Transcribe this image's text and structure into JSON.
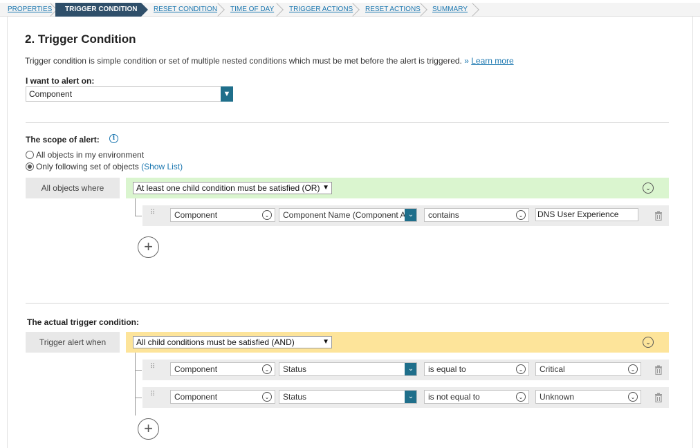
{
  "wizard": {
    "steps": [
      {
        "label": "PROPERTIES",
        "active": false
      },
      {
        "label": "TRIGGER CONDITION",
        "active": true
      },
      {
        "label": "RESET CONDITION",
        "active": false
      },
      {
        "label": "TIME OF DAY",
        "active": false
      },
      {
        "label": "TRIGGER ACTIONS",
        "active": false
      },
      {
        "label": "RESET ACTIONS",
        "active": false
      },
      {
        "label": "SUMMARY",
        "active": false
      }
    ]
  },
  "page": {
    "title": "2. Trigger Condition",
    "description": "Trigger condition is simple condition or set of multiple nested conditions which must be met before the alert is triggered.",
    "learn_more_prefix": "»",
    "learn_more": "Learn more"
  },
  "alert_on": {
    "label": "I want to alert on:",
    "value": "Component"
  },
  "scope": {
    "label": "The scope of alert:",
    "options": [
      {
        "label": "All objects in my environment",
        "selected": false
      },
      {
        "label": "Only following set of objects",
        "selected": true,
        "link": "(Show List)"
      }
    ],
    "group_label": "All objects where",
    "group_operator": "At least one child condition must be satisfied (OR)",
    "conditions": [
      {
        "entity": "Component",
        "field": "Component Name (Component A",
        "operator": "contains",
        "value": "DNS User Experience"
      }
    ]
  },
  "trigger": {
    "label": "The actual trigger condition:",
    "group_label": "Trigger alert when",
    "group_operator": "All child conditions must be satisfied (AND)",
    "conditions": [
      {
        "entity": "Component",
        "field": "Status",
        "operator": "is equal to",
        "value": "Critical"
      },
      {
        "entity": "Component",
        "field": "Status",
        "operator": "is not equal to",
        "value": "Unknown"
      }
    ]
  },
  "icons": {
    "info": "info-icon",
    "trash": "trash-icon",
    "plus": "plus-circle-icon",
    "chevron": "chevron-down-icon",
    "grip": "drag-handle-icon"
  },
  "colors": {
    "active_step": "#2f4f6a",
    "link": "#1b77b0",
    "dropdown_button": "#1f6f8b",
    "scope_group_bg": "#daf5cf",
    "trigger_group_bg": "#fde49a"
  }
}
